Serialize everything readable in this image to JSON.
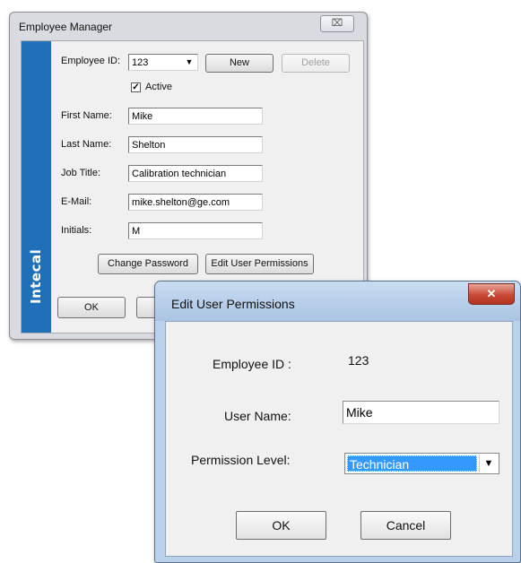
{
  "employee_manager": {
    "title": "Employee Manager",
    "close_glyph": "⌧",
    "sidebar_brand": "Intecal",
    "employee_id_label": "Employee ID:",
    "employee_id_value": "123",
    "new_label": "New",
    "delete_label": "Delete",
    "active_label": "Active",
    "active_checked": true,
    "first_name_label": "First Name:",
    "first_name_value": "Mike",
    "last_name_label": "Last Name:",
    "last_name_value": "Shelton",
    "job_title_label": "Job Title:",
    "job_title_value": "Calibration technician",
    "email_label": "E-Mail:",
    "email_value": "mike.shelton@ge.com",
    "initials_label": "Initials:",
    "initials_value": "M",
    "change_password_label": "Change Password",
    "edit_permissions_label": "Edit User Permissions",
    "ok_label": "OK"
  },
  "edit_permissions": {
    "title": "Edit User Permissions",
    "close_glyph": "✕",
    "employee_id_label": "Employee ID :",
    "employee_id_value": "123",
    "user_name_label": "User Name:",
    "user_name_value": "Mike",
    "permission_level_label": "Permission Level:",
    "permission_level_value": "Technician",
    "ok_label": "OK",
    "cancel_label": "Cancel"
  },
  "colors": {
    "brand_stripe": "#1f6fb9",
    "selection": "#3399ff",
    "close_button_red": "#c94a35",
    "dialog_frame": "#b9d1ea"
  },
  "icons": {
    "dropdown": "chevron-down-icon",
    "check": "checkmark-icon",
    "close": "close-icon"
  }
}
